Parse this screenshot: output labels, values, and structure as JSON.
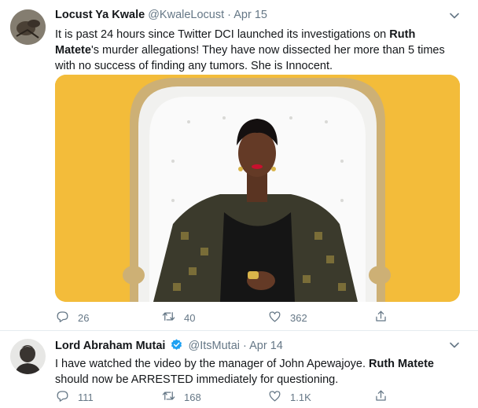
{
  "tweets": [
    {
      "author": "Locust Ya Kwale",
      "handle": "@KwaleLocust",
      "dot": "·",
      "date": "Apr 15",
      "text_part1": "It is past 24 hours since Twitter DCI launched its investigations on ",
      "text_bold": "Ruth Matete",
      "text_part2": "'s murder allegations! They have now dissected her more than 5 times with no success of finding any tumors. She is Innocent.",
      "replies": "26",
      "retweets": "40",
      "likes": "362"
    },
    {
      "author": "Lord Abraham Mutai",
      "handle": "@ItsMutai",
      "dot": "·",
      "date": "Apr 14",
      "text_part1": "I have watched the video by the manager of John Apewajoye. ",
      "text_bold": "Ruth Matete",
      "text_part2": " should now be ARRESTED immediately for questioning.",
      "replies": "111",
      "retweets": "168",
      "likes": "1.1K"
    }
  ],
  "colors": {
    "accent": "#1da1f2",
    "muted": "#657786",
    "photo_bg": "#f3bc3a"
  }
}
